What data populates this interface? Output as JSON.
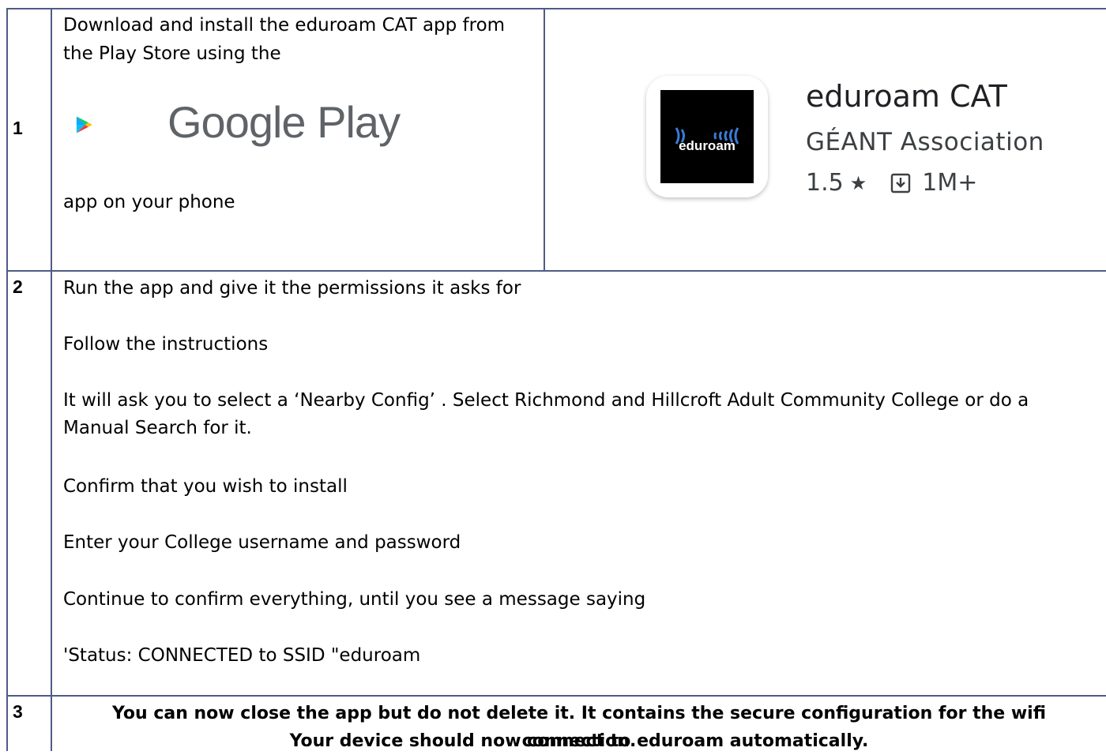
{
  "rows": [
    {
      "number": "1",
      "text_before": "Download and install the eduroam CAT app from the Play Store using the",
      "logo_text": "Google Play",
      "text_after": "app on your phone",
      "app": {
        "name": "eduroam CAT",
        "developer": "GÉANT Association",
        "rating": "1.5",
        "downloads": "1M+",
        "icon_text": "eduroam"
      }
    },
    {
      "number": "2",
      "lines": [
        "Run the app and give it the permissions it asks for",
        "Follow the instructions",
        "It will ask you to select a ‘Nearby Config’ .  Select  Richmond and Hillcroft Adult Community College or do a Manual Search for it.",
        "Confirm that you wish to install",
        "Enter your College username and password",
        "Continue to confirm everything, until you see a message saying",
        "'Status: CONNECTED to SSID \"eduroam"
      ]
    },
    {
      "number": "3",
      "line1": "You can now close the app but do not delete it.  It contains the secure configuration for the wifi connection.",
      "line2": "Your device should now connect to eduroam automatically."
    }
  ],
  "colors": {
    "border": "#4f5b86",
    "logo_text": "#5f6368"
  }
}
